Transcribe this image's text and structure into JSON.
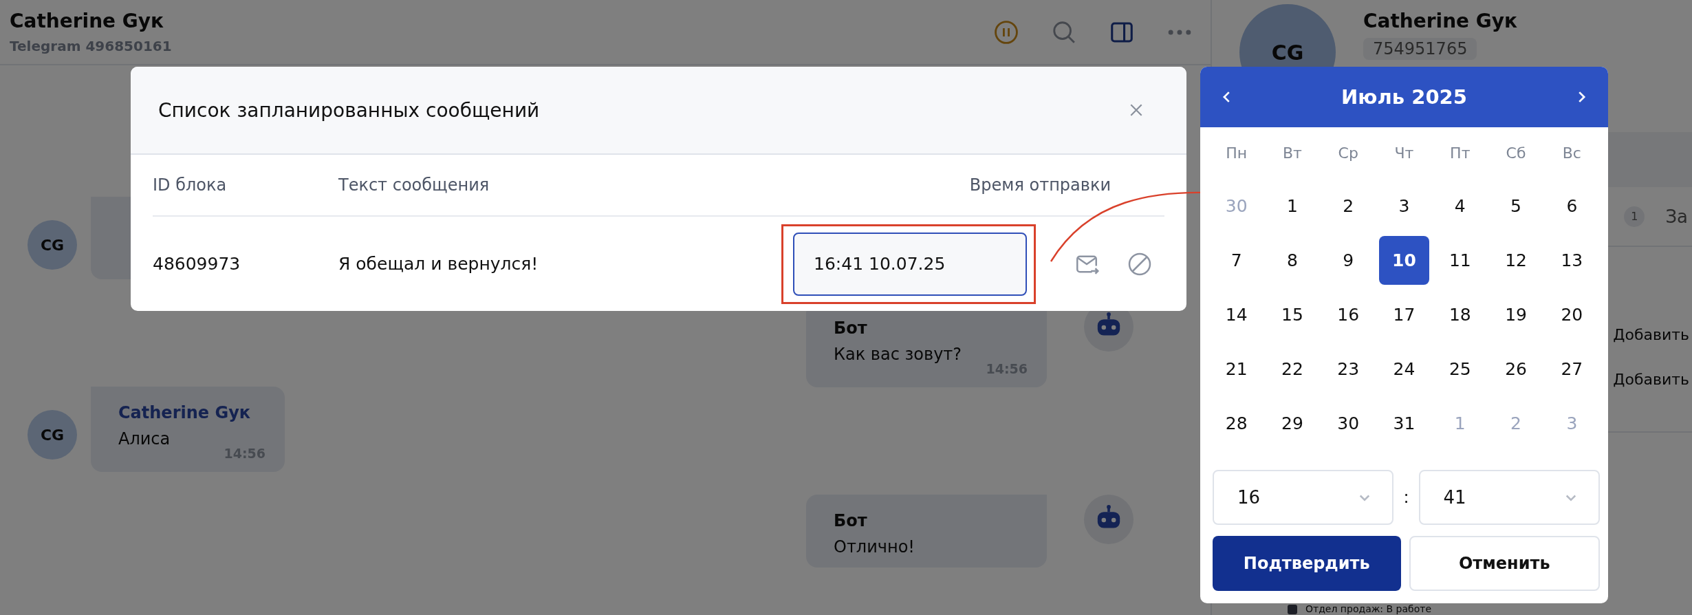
{
  "header": {
    "title": "Catherine Gyк",
    "subtitle": "Telegram 496850161"
  },
  "chat": {
    "messages": [
      {
        "kind": "contact",
        "avatar": "CG"
      },
      {
        "kind": "bot",
        "author": "Бот",
        "text": "Как вас зовут?",
        "time": "14:56"
      },
      {
        "kind": "contact",
        "avatar": "CG",
        "author": "Catherine Gyк",
        "text": "Алиса",
        "time": "14:56"
      },
      {
        "kind": "bot",
        "author": "Бот",
        "text": "Отлично!"
      }
    ]
  },
  "side_panel": {
    "avatar": "CG",
    "name": "Catherine Gyк",
    "id_badge": "754951765",
    "tab_counter": "1",
    "tab_label": "За",
    "add_links": [
      "Добавить",
      "Добавить"
    ],
    "status": "Отдел продаж: В работе"
  },
  "dialog": {
    "title": "Список запланированных сообщений",
    "columns": [
      "ID блока",
      "Текст сообщения",
      "Время отправки"
    ],
    "rows": [
      {
        "block_id": "48609973",
        "text": "Я обещал и вернулся!",
        "send_time": "16:41 10.07.25",
        "highlighted": true
      }
    ]
  },
  "calendar": {
    "month": "Июль 2025",
    "weekdays": [
      "Пн",
      "Вт",
      "Ср",
      "Чт",
      "Пт",
      "Сб",
      "Вс"
    ],
    "days": [
      {
        "day": "30",
        "outside": true,
        "selected": false
      },
      {
        "day": "1",
        "outside": false,
        "selected": false
      },
      {
        "day": "2",
        "outside": false,
        "selected": false
      },
      {
        "day": "3",
        "outside": false,
        "selected": false
      },
      {
        "day": "4",
        "outside": false,
        "selected": false
      },
      {
        "day": "5",
        "outside": false,
        "selected": false
      },
      {
        "day": "6",
        "outside": false,
        "selected": false
      },
      {
        "day": "7",
        "outside": false,
        "selected": false
      },
      {
        "day": "8",
        "outside": false,
        "selected": false
      },
      {
        "day": "9",
        "outside": false,
        "selected": false
      },
      {
        "day": "10",
        "outside": false,
        "selected": true
      },
      {
        "day": "11",
        "outside": false,
        "selected": false
      },
      {
        "day": "12",
        "outside": false,
        "selected": false
      },
      {
        "day": "13",
        "outside": false,
        "selected": false
      },
      {
        "day": "14",
        "outside": false,
        "selected": false
      },
      {
        "day": "15",
        "outside": false,
        "selected": false
      },
      {
        "day": "16",
        "outside": false,
        "selected": false
      },
      {
        "day": "17",
        "outside": false,
        "selected": false
      },
      {
        "day": "18",
        "outside": false,
        "selected": false
      },
      {
        "day": "19",
        "outside": false,
        "selected": false
      },
      {
        "day": "20",
        "outside": false,
        "selected": false
      },
      {
        "day": "21",
        "outside": false,
        "selected": false
      },
      {
        "day": "22",
        "outside": false,
        "selected": false
      },
      {
        "day": "23",
        "outside": false,
        "selected": false
      },
      {
        "day": "24",
        "outside": false,
        "selected": false
      },
      {
        "day": "25",
        "outside": false,
        "selected": false
      },
      {
        "day": "26",
        "outside": false,
        "selected": false
      },
      {
        "day": "27",
        "outside": false,
        "selected": false
      },
      {
        "day": "28",
        "outside": false,
        "selected": false
      },
      {
        "day": "29",
        "outside": false,
        "selected": false
      },
      {
        "day": "30",
        "outside": false,
        "selected": false
      },
      {
        "day": "31",
        "outside": false,
        "selected": false
      },
      {
        "day": "1",
        "outside": true,
        "selected": false
      },
      {
        "day": "2",
        "outside": true,
        "selected": false
      },
      {
        "day": "3",
        "outside": true,
        "selected": false
      }
    ],
    "hour": "16",
    "separator": ":",
    "minute": "41",
    "confirm": "Подтвердить",
    "cancel": "Отменить"
  }
}
